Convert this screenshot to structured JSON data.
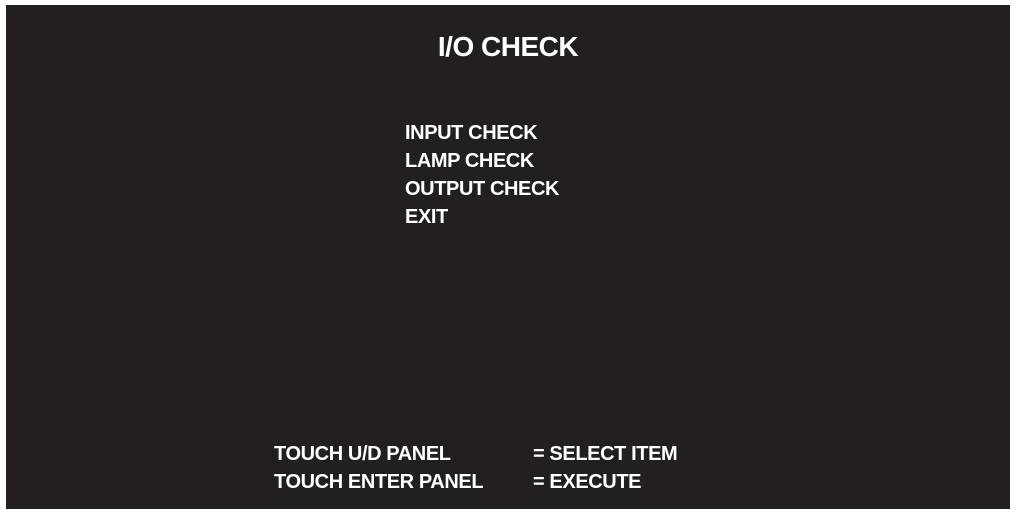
{
  "title": "I/O CHECK",
  "menu": {
    "items": [
      {
        "label": "INPUT CHECK"
      },
      {
        "label": "LAMP CHECK"
      },
      {
        "label": "OUTPUT CHECK"
      },
      {
        "label": "EXIT"
      }
    ]
  },
  "help": {
    "rows": [
      {
        "key": "TOUCH U/D PANEL",
        "action": "= SELECT ITEM"
      },
      {
        "key": "TOUCH ENTER PANEL",
        "action": "= EXECUTE"
      }
    ]
  },
  "colors": {
    "background": "#231f20",
    "text": "#ffffff"
  }
}
